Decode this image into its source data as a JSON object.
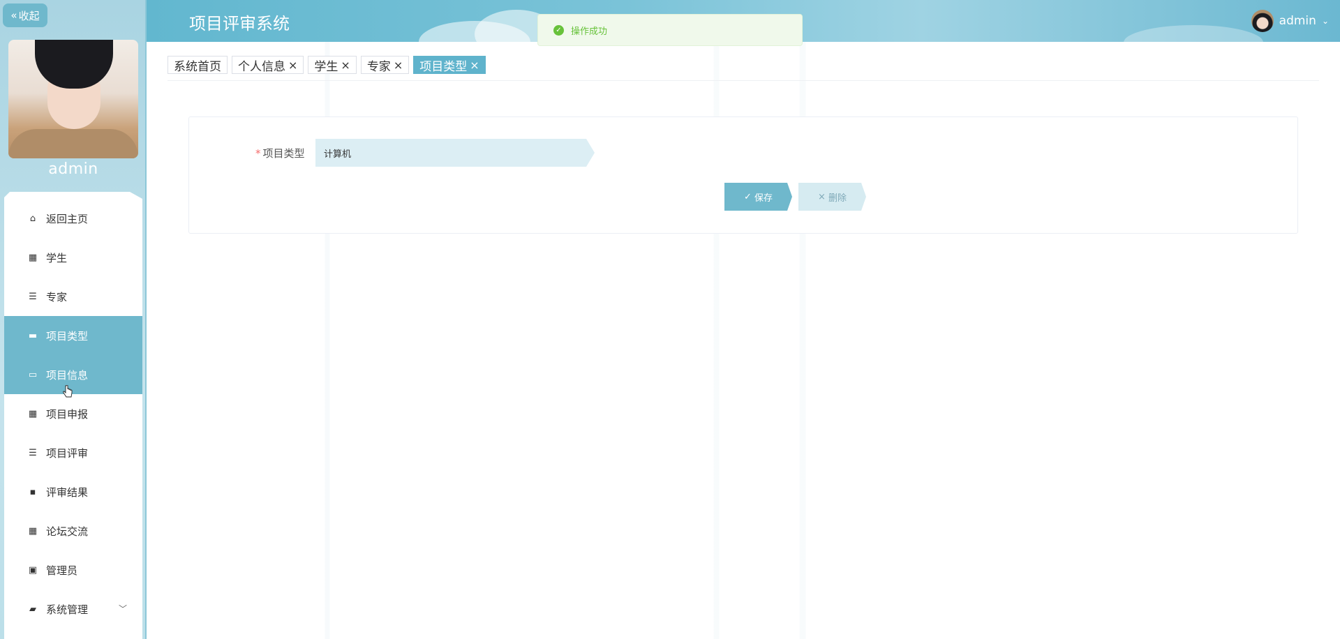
{
  "sidebar": {
    "collapse_label": "收起",
    "username": "admin",
    "menu": [
      {
        "label": "返回主页",
        "icon": "home-icon",
        "glyph": "⌂"
      },
      {
        "label": "学生",
        "icon": "grid-icon",
        "glyph": "▦"
      },
      {
        "label": "专家",
        "icon": "list-icon",
        "glyph": "☰"
      },
      {
        "label": "项目类型",
        "icon": "briefcase-icon",
        "glyph": "▬",
        "active": true
      },
      {
        "label": "项目信息",
        "icon": "monitor-icon",
        "glyph": "▭",
        "active": true
      },
      {
        "label": "项目申报",
        "icon": "grid-icon",
        "glyph": "▦"
      },
      {
        "label": "项目评审",
        "icon": "list-icon",
        "glyph": "☰"
      },
      {
        "label": "评审结果",
        "icon": "comment-icon",
        "glyph": "▪"
      },
      {
        "label": "论坛交流",
        "icon": "grid-icon",
        "glyph": "▦"
      },
      {
        "label": "管理员",
        "icon": "clipboard-icon",
        "glyph": "▣"
      },
      {
        "label": "系统管理",
        "icon": "folder-icon",
        "glyph": "▰",
        "has_submenu": true
      }
    ]
  },
  "header": {
    "title": "项目评审系统",
    "username": "admin"
  },
  "toast": {
    "message": "操作成功",
    "type": "success"
  },
  "tabs": [
    {
      "label": "系统首页",
      "closable": false
    },
    {
      "label": "个人信息",
      "closable": true
    },
    {
      "label": "学生",
      "closable": true
    },
    {
      "label": "专家",
      "closable": true
    },
    {
      "label": "项目类型",
      "closable": true,
      "active": true
    }
  ],
  "form": {
    "field_label": "项目类型",
    "field_value": "计算机",
    "save_label": "保存",
    "delete_label": "删除"
  },
  "colors": {
    "accent": "#6fb8cc",
    "success": "#67c23a",
    "required": "#f56c6c"
  }
}
